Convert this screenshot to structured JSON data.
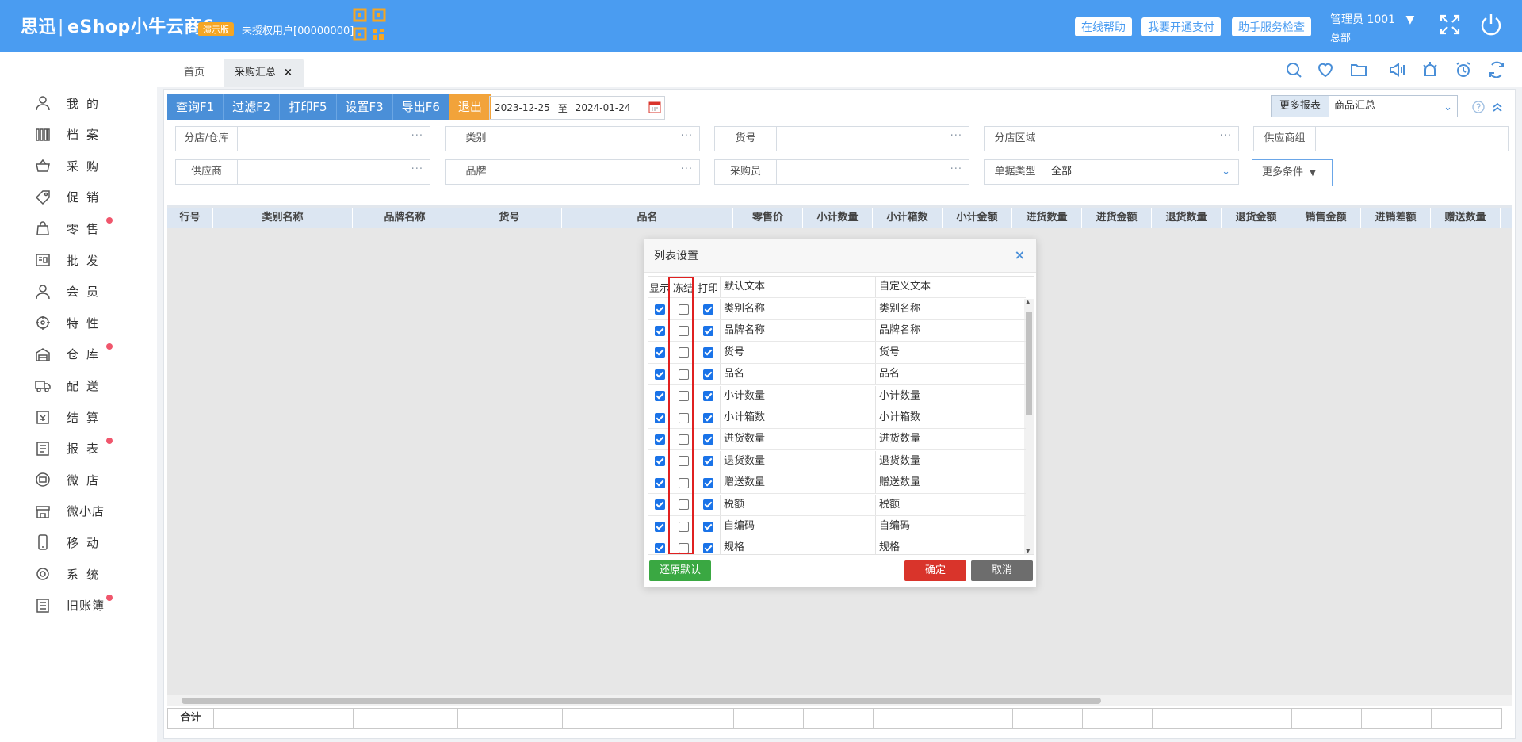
{
  "header": {
    "brand_main": "思迅",
    "brand_sub": "eShop小牛云商6",
    "demo_badge": "演示版",
    "unauth_text": "未授权用户[00000000]",
    "buttons": [
      "在线帮助",
      "我要开通支付",
      "助手服务检查"
    ],
    "admin": "管理员 1001",
    "admin_caret": "▼",
    "branch": "总部"
  },
  "sidebar": {
    "items": [
      {
        "label": "我的",
        "icon": "user-icon",
        "dot": false
      },
      {
        "label": "档案",
        "icon": "archive-icon",
        "dot": false
      },
      {
        "label": "采购",
        "icon": "basket-icon",
        "dot": false
      },
      {
        "label": "促销",
        "icon": "tag-icon",
        "dot": false
      },
      {
        "label": "零售",
        "icon": "shopping-bag-icon",
        "dot": true
      },
      {
        "label": "批发",
        "icon": "wholesale-icon",
        "dot": false
      },
      {
        "label": "会员",
        "icon": "member-icon",
        "dot": false
      },
      {
        "label": "特性",
        "icon": "feature-icon",
        "dot": false
      },
      {
        "label": "仓库",
        "icon": "warehouse-icon",
        "dot": true
      },
      {
        "label": "配送",
        "icon": "truck-icon",
        "dot": false
      },
      {
        "label": "结算",
        "icon": "settlement-icon",
        "dot": false
      },
      {
        "label": "报表",
        "icon": "report-icon",
        "dot": true
      },
      {
        "label": "微店",
        "icon": "micro-shop-icon",
        "dot": false
      },
      {
        "label": "微小店",
        "icon": "mini-shop-icon",
        "dot": false
      },
      {
        "label": "移动",
        "icon": "mobile-icon",
        "dot": false
      },
      {
        "label": "系统",
        "icon": "settings-icon",
        "dot": false
      },
      {
        "label": "旧账簿",
        "icon": "ledger-icon",
        "dot": true
      }
    ]
  },
  "tabs": {
    "home": "首页",
    "current": "采购汇总",
    "close": "×"
  },
  "toolbar": {
    "buttons": [
      "查询F1",
      "过滤F2",
      "打印F5",
      "设置F3",
      "导出F6",
      "退出"
    ],
    "date_from": "2023-12-25",
    "date_to_sep": "至",
    "date_to": "2024-01-24",
    "more_reports_label": "更多报表",
    "more_reports_value": "商品汇总"
  },
  "filters": {
    "row1": [
      {
        "label": "分店/仓库",
        "value": ""
      },
      {
        "label": "类别",
        "value": ""
      },
      {
        "label": "货号",
        "value": ""
      },
      {
        "label": "分店区域",
        "value": ""
      },
      {
        "label": "供应商组",
        "value": ""
      }
    ],
    "row2": [
      {
        "label": "供应商",
        "value": ""
      },
      {
        "label": "品牌",
        "value": ""
      },
      {
        "label": "采购员",
        "value": ""
      },
      {
        "label": "单据类型",
        "value": "全部"
      }
    ],
    "more_conditions": "更多条件",
    "ellipsis": "···"
  },
  "grid": {
    "columns": [
      "行号",
      "类别名称",
      "品牌名称",
      "货号",
      "品名",
      "零售价",
      "小计数量",
      "小计箱数",
      "小计金额",
      "进货数量",
      "进货金额",
      "退货数量",
      "退货金额",
      "销售金额",
      "进销差额",
      "赠送数量"
    ],
    "footer_label": "合计"
  },
  "modal": {
    "title": "列表设置",
    "close": "×",
    "headers": {
      "show": "显示",
      "freeze": "冻结",
      "print": "打印",
      "default_text": "默认文本",
      "custom_text": "自定义文本"
    },
    "rows": [
      {
        "show": true,
        "freeze": false,
        "print": true,
        "default": "类别名称",
        "custom": "类别名称"
      },
      {
        "show": true,
        "freeze": false,
        "print": true,
        "default": "品牌名称",
        "custom": "品牌名称"
      },
      {
        "show": true,
        "freeze": false,
        "print": true,
        "default": "货号",
        "custom": "货号"
      },
      {
        "show": true,
        "freeze": false,
        "print": true,
        "default": "品名",
        "custom": "品名"
      },
      {
        "show": true,
        "freeze": false,
        "print": true,
        "default": "小计数量",
        "custom": "小计数量"
      },
      {
        "show": true,
        "freeze": false,
        "print": true,
        "default": "小计箱数",
        "custom": "小计箱数"
      },
      {
        "show": true,
        "freeze": false,
        "print": true,
        "default": "进货数量",
        "custom": "进货数量"
      },
      {
        "show": true,
        "freeze": false,
        "print": true,
        "default": "退货数量",
        "custom": "退货数量"
      },
      {
        "show": true,
        "freeze": false,
        "print": true,
        "default": "赠送数量",
        "custom": "赠送数量"
      },
      {
        "show": true,
        "freeze": false,
        "print": true,
        "default": "税额",
        "custom": "税额"
      },
      {
        "show": true,
        "freeze": false,
        "print": true,
        "default": "自编码",
        "custom": "自编码"
      },
      {
        "show": true,
        "freeze": false,
        "print": true,
        "default": "规格",
        "custom": "规格"
      }
    ],
    "restore_button": "还原默认",
    "ok_button": "确定",
    "cancel_button": "取消"
  },
  "colors": {
    "header_bg": "#4a9cf1",
    "toolbar_btn": "#4a8fd8",
    "exit_btn": "#f2a33a",
    "badge_dot": "#f0566c",
    "highlight_border": "#e02020",
    "restore_btn": "#3aa842",
    "ok_btn": "#d9342b",
    "cancel_btn": "#6d6d6d"
  }
}
